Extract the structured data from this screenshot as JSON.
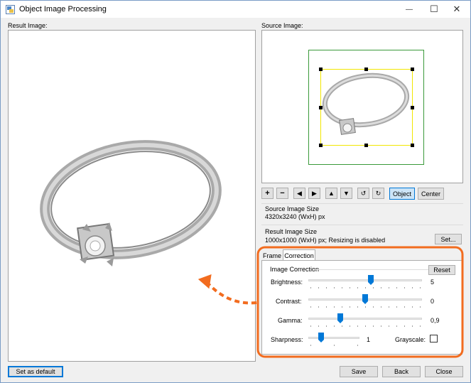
{
  "window": {
    "title": "Object Image Processing",
    "minimize_glyph": "—",
    "maximize_glyph": "☐",
    "close_glyph": "✕"
  },
  "result_panel": {
    "label": "Result Image:"
  },
  "source_panel": {
    "label": "Source Image:"
  },
  "toolbar": {
    "zoom_in": "+",
    "zoom_out": "−",
    "move_left": "◀",
    "move_right": "▶",
    "move_up": "▲",
    "move_down": "▼",
    "rotate_left": "↺",
    "rotate_right": "↻",
    "object_label": "Object",
    "center_label": "Center"
  },
  "source_size": {
    "label": "Source Image Size",
    "value": "4320x3240 (WxH) px"
  },
  "result_size": {
    "label": "Result Image Size",
    "value": "1000x1000 (WxH) px; Resizing is disabled",
    "set_label": "Set..."
  },
  "tabs": [
    {
      "label": "Frame"
    },
    {
      "label": "Correction"
    }
  ],
  "correction": {
    "group_label": "Image Correction",
    "reset_label": "Reset",
    "brightness": {
      "label": "Brightness:",
      "value": "5",
      "level": 0.55
    },
    "contrast": {
      "label": "Contrast:",
      "value": "0",
      "level": 0.5
    },
    "gamma": {
      "label": "Gamma:",
      "value": "0,9",
      "level": 0.28
    },
    "sharpness": {
      "label": "Sharpness:",
      "value": "1",
      "level": 0.25
    },
    "grayscale_label": "Grayscale:"
  },
  "footer": {
    "set_default_label": "Set as default",
    "save_label": "Save",
    "back_label": "Back",
    "close_label": "Close"
  },
  "colors": {
    "annotation_orange": "#f26c1f",
    "frame_green": "#3a9a3a",
    "selection_yellow": "#f2e600",
    "accent_blue": "#0078d7"
  }
}
